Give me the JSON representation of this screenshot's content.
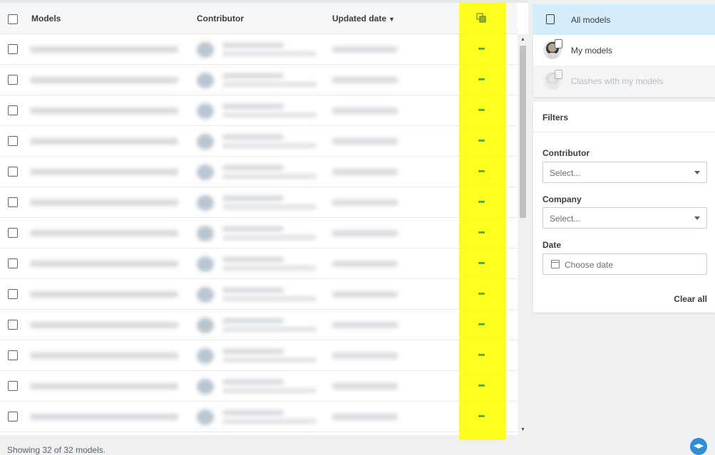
{
  "table": {
    "headers": {
      "models": "Models",
      "contributor": "Contributor",
      "updated_date": "Updated date"
    },
    "row_count_visible": 13,
    "row_action_label": "•••"
  },
  "footer": {
    "status": "Showing 32 of 32 models."
  },
  "views": {
    "all_models": "All models",
    "my_models": "My models",
    "clashes": "Clashes with my models"
  },
  "filters": {
    "title": "Filters",
    "contributor_label": "Contributor",
    "contributor_placeholder": "Select...",
    "company_label": "Company",
    "company_placeholder": "Select...",
    "date_label": "Date",
    "date_placeholder": "Choose date",
    "clear_all": "Clear all"
  },
  "colors": {
    "highlight": "#ffff00",
    "selected_view_bg": "#d4edfb",
    "action_dots": "#3aa83a",
    "help_button": "#2f8fd6"
  },
  "icons": {
    "header_column_icon": "column-toggle-icon",
    "sort": "chevron-down-icon",
    "help": "help-graduation-cap-icon"
  }
}
